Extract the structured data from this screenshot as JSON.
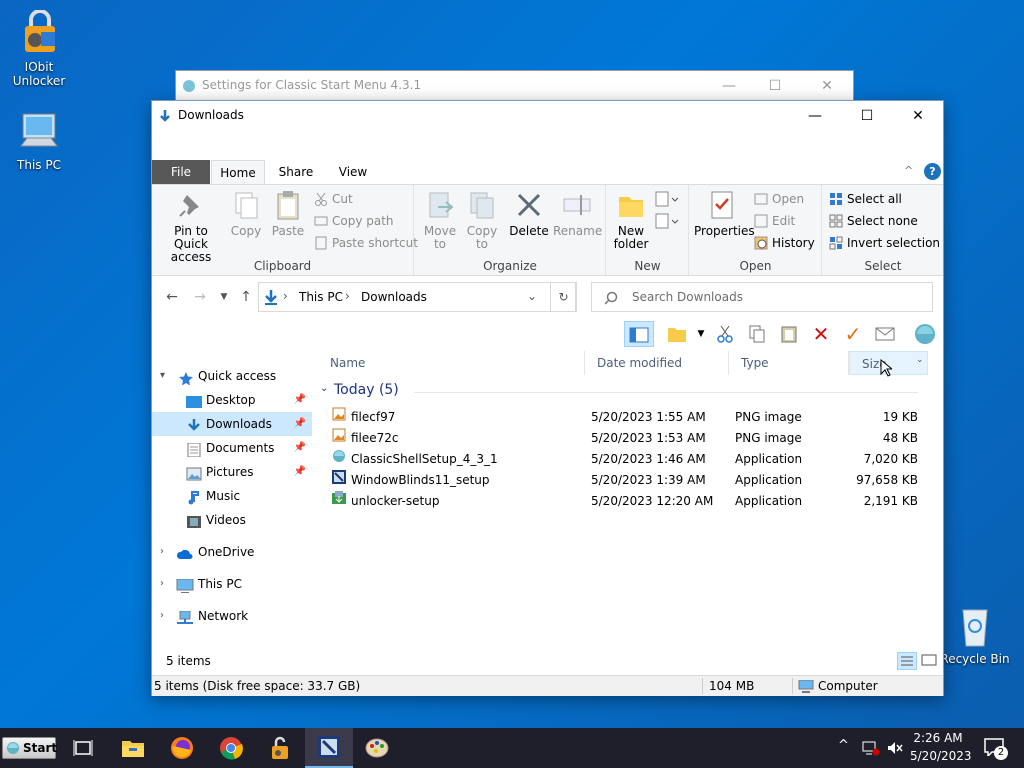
{
  "desktop": {
    "icons": [
      {
        "label_line1": "IObit",
        "label_line2": "Unlocker"
      },
      {
        "label_line1": "This PC",
        "label_line2": ""
      },
      {
        "label_line1": "Recycle Bin",
        "label_line2": ""
      }
    ]
  },
  "background_window": {
    "title": "Settings for Classic Start Menu 4.3.1",
    "min": "—",
    "max": "☐",
    "close": "✕"
  },
  "window": {
    "title": "Downloads",
    "min": "—",
    "max": "☐",
    "close": "✕",
    "tabs": {
      "file": "File",
      "home": "Home",
      "share": "Share",
      "view": "View"
    },
    "help": "?",
    "collapse": "^"
  },
  "ribbon": {
    "clipboard": {
      "pin": "Pin to Quick",
      "pin2": "access",
      "copy": "Copy",
      "paste": "Paste",
      "cut": "Cut",
      "copy_path": "Copy path",
      "paste_shortcut": "Paste shortcut",
      "label": "Clipboard"
    },
    "organize": {
      "move_to": "Move",
      "move_to2": "to",
      "copy_to": "Copy",
      "copy_to2": "to",
      "delete": "Delete",
      "rename": "Rename",
      "label": "Organize"
    },
    "new": {
      "new_folder": "New",
      "new_folder2": "folder",
      "label": "New"
    },
    "open": {
      "properties": "Properties",
      "open": "Open",
      "edit": "Edit",
      "history": "History",
      "label": "Open"
    },
    "select": {
      "select_all": "Select all",
      "select_none": "Select none",
      "invert": "Invert selection",
      "label": "Select"
    }
  },
  "address": {
    "crumb1": "This PC",
    "crumb2": "Downloads",
    "search_placeholder": "Search Downloads"
  },
  "columns": {
    "name": "Name",
    "date": "Date modified",
    "type": "Type",
    "size": "Size"
  },
  "group": {
    "label": "Today (5)"
  },
  "files": [
    {
      "name": "filecf97",
      "date": "5/20/2023 1:55 AM",
      "type": "PNG image",
      "size": "19 KB"
    },
    {
      "name": "filee72c",
      "date": "5/20/2023 1:53 AM",
      "type": "PNG image",
      "size": "48 KB"
    },
    {
      "name": "ClassicShellSetup_4_3_1",
      "date": "5/20/2023 1:46 AM",
      "type": "Application",
      "size": "7,020 KB"
    },
    {
      "name": "WindowBlinds11_setup",
      "date": "5/20/2023 1:39 AM",
      "type": "Application",
      "size": "97,658 KB"
    },
    {
      "name": "unlocker-setup",
      "date": "5/20/2023 12:20 AM",
      "type": "Application",
      "size": "2,191 KB"
    }
  ],
  "nav": {
    "quick_access": "Quick access",
    "desktop": "Desktop",
    "downloads": "Downloads",
    "documents": "Documents",
    "pictures": "Pictures",
    "music": "Music",
    "videos": "Videos",
    "onedrive": "OneDrive",
    "this_pc": "This PC",
    "network": "Network"
  },
  "status": {
    "items": "5 items",
    "detail": "5 items (Disk free space: 33.7 GB)",
    "size": "104 MB",
    "location": "Computer"
  },
  "taskbar": {
    "start": "Start",
    "time": "2:26 AM",
    "date": "5/20/2023",
    "notif_count": "2"
  }
}
